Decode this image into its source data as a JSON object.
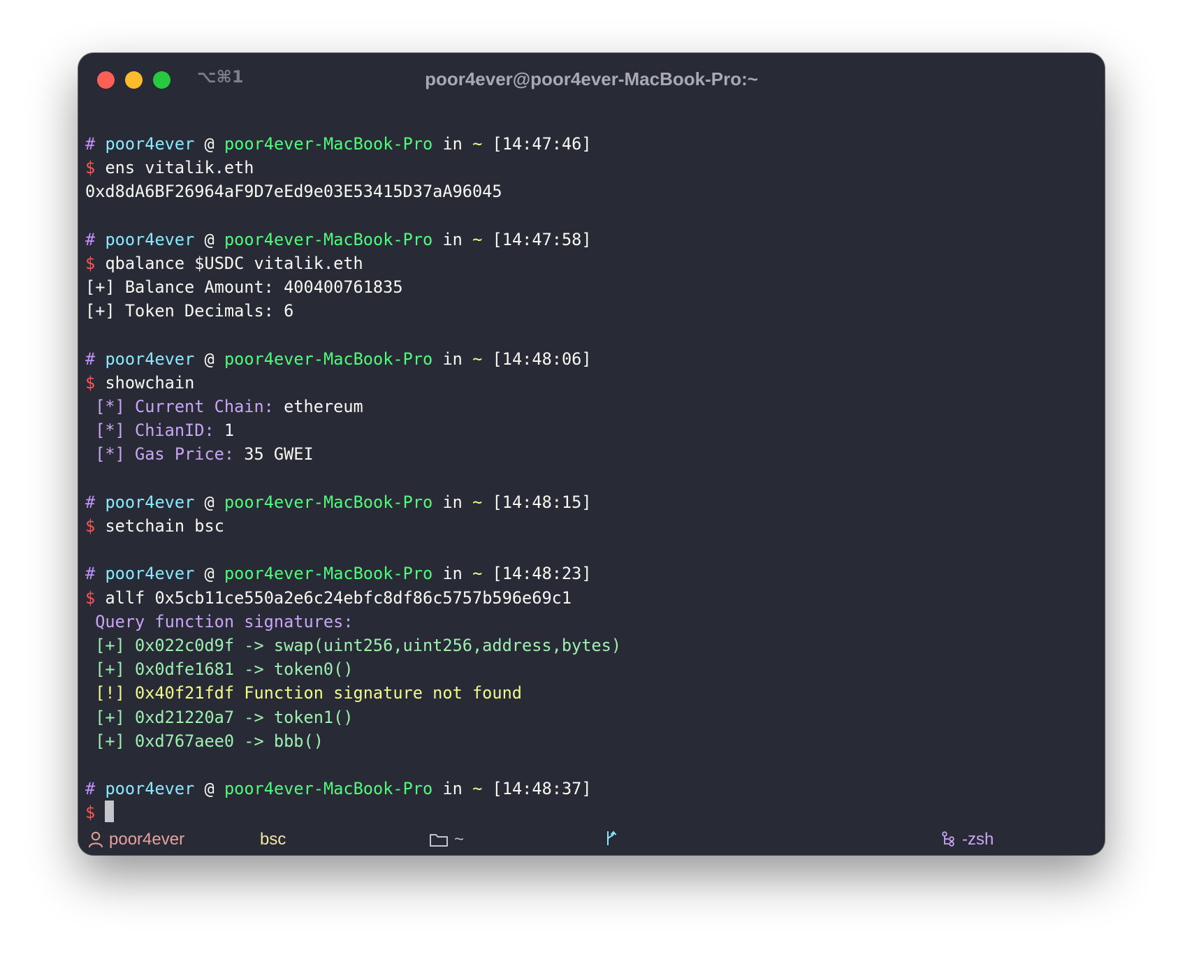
{
  "window": {
    "shortcut": "⌥⌘1",
    "title": "poor4ever@poor4ever-MacBook-Pro:~"
  },
  "prompt": {
    "hash": "#",
    "user": "poor4ever",
    "at": "@",
    "host": "poor4ever-MacBook-Pro",
    "in": "in",
    "dir": "~",
    "dollar": "$"
  },
  "blocks": [
    {
      "time": "[14:47:46]",
      "command": "ens vitalik.eth",
      "output": [
        {
          "parts": [
            {
              "text": "0xd8dA6BF26964aF9D7eEd9e03E53415D37aA96045",
              "color": "white"
            }
          ]
        }
      ]
    },
    {
      "time": "[14:47:58]",
      "command": "qbalance $USDC vitalik.eth",
      "output": [
        {
          "parts": [
            {
              "text": "[+] Balance Amount: 400400761835",
              "color": "white"
            }
          ]
        },
        {
          "parts": [
            {
              "text": "[+] Token Decimals: 6",
              "color": "white"
            }
          ]
        }
      ]
    },
    {
      "time": "[14:48:06]",
      "command": "showchain",
      "output": [
        {
          "parts": [
            {
              "text": " [*] Current Chain: ",
              "color": "lilac"
            },
            {
              "text": "ethereum",
              "color": "white"
            }
          ]
        },
        {
          "parts": [
            {
              "text": " [*] ChianID: ",
              "color": "lilac"
            },
            {
              "text": "1",
              "color": "white"
            }
          ]
        },
        {
          "parts": [
            {
              "text": " [*] Gas Price: ",
              "color": "lilac"
            },
            {
              "text": "35 GWEI",
              "color": "white"
            }
          ]
        }
      ]
    },
    {
      "time": "[14:48:15]",
      "command": "setchain bsc",
      "output": []
    },
    {
      "time": "[14:48:23]",
      "command": "allf 0x5cb11ce550a2e6c24ebfc8df86c5757b596e69c1",
      "output": [
        {
          "parts": [
            {
              "text": " Query function signatures:",
              "color": "lilac"
            }
          ]
        },
        {
          "parts": [
            {
              "text": " [+] 0x022c0d9f -> swap(uint256,uint256,address,bytes)",
              "color": "mint"
            }
          ]
        },
        {
          "parts": [
            {
              "text": " [+] 0x0dfe1681 -> token0()",
              "color": "mint"
            }
          ]
        },
        {
          "parts": [
            {
              "text": " [!] 0x40f21fdf Function signature not found",
              "color": "yellow"
            }
          ]
        },
        {
          "parts": [
            {
              "text": " [+] 0xd21220a7 -> token1()",
              "color": "mint"
            }
          ]
        },
        {
          "parts": [
            {
              "text": " [+] 0xd767aee0 -> bbb()",
              "color": "mint"
            }
          ]
        }
      ]
    }
  ],
  "last_prompt": {
    "time": "[14:48:37]"
  },
  "statusbar": {
    "user": "poor4ever",
    "chain": "bsc",
    "dir": "~",
    "shell": "-zsh"
  },
  "colors": {
    "background": "#282a36",
    "purple": "#bd93f9",
    "cyan": "#8be9fd",
    "green": "#50fa7b",
    "red": "#ff5555",
    "yellow": "#f1fa8c"
  }
}
